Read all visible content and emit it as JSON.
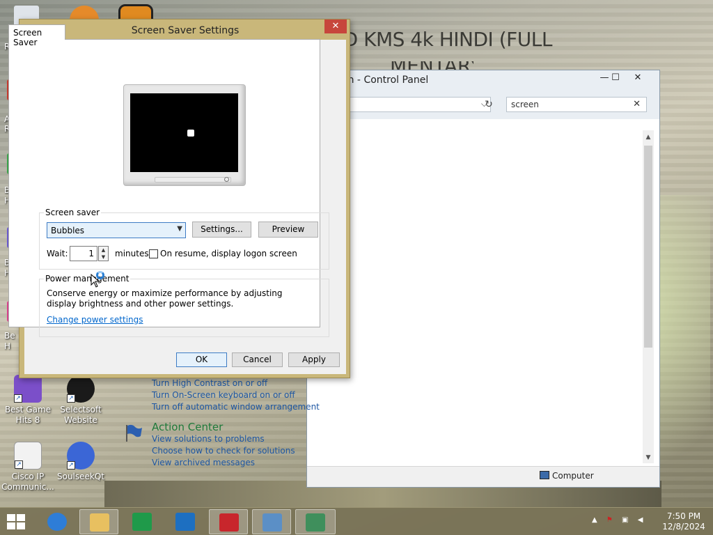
{
  "wallpaper": {
    "video_title": "AD KMS 4k HINDI (FULL",
    "video_title_line2": "MENTARY)"
  },
  "desktop_icons": [
    {
      "label": "Best Game Hits 8"
    },
    {
      "label": "Selectsoft Website"
    },
    {
      "label": "Cisco IP Communic..."
    },
    {
      "label": "SoulseekQt"
    }
  ],
  "left_strip_labels": [
    "Rec",
    "A",
    "Re",
    "Be",
    "H",
    "Be",
    "H",
    "Be",
    "H"
  ],
  "control_panel": {
    "title": "en - Control Panel",
    "controls": {
      "minimize": "—",
      "maximize": "☐",
      "close": "✕"
    },
    "search_value": "screen",
    "links": [
      "Turn High Contrast on or off",
      "Turn On-Screen keyboard on or off",
      "Turn off automatic window arrangement"
    ],
    "action_center": {
      "title": "Action Center",
      "links": [
        "View solutions to problems",
        "Choose how to check for solutions",
        "View archived messages"
      ]
    },
    "status_text": "Computer"
  },
  "dialog": {
    "title": "Screen Saver Settings",
    "close_label": "✕",
    "tab_label": "Screen Saver",
    "screen_saver_group": "Screen saver",
    "selected_saver": "Bubbles",
    "settings_button": "Settings...",
    "preview_button": "Preview",
    "wait_label": "Wait:",
    "wait_value": "1",
    "minutes_label": "minutes",
    "logon_checkbox_label": "On resume, display logon screen",
    "logon_checked": false,
    "power_group": "Power management",
    "power_text": "Conserve energy or maximize performance by adjusting display brightness and other power settings.",
    "power_link": "Change power settings",
    "ok_button": "OK",
    "cancel_button": "Cancel",
    "apply_button": "Apply"
  },
  "taskbar": {
    "time": "7:50 PM",
    "date": "12/8/2024",
    "apps": [
      "internet-explorer",
      "file-explorer",
      "store",
      "mail",
      "media-app",
      "control-panel",
      "display-settings"
    ]
  }
}
